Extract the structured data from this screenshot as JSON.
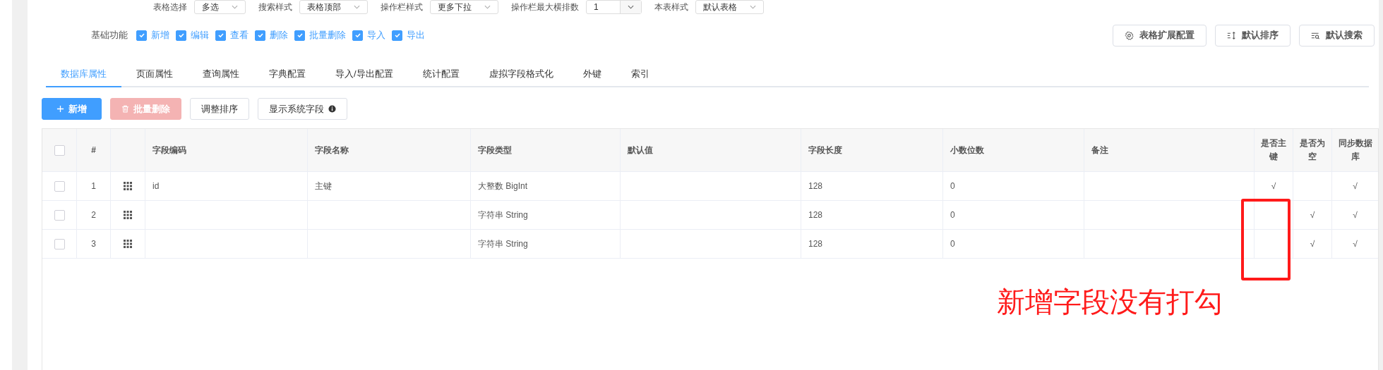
{
  "top_settings": [
    {
      "label": "表格选择",
      "value": "多选",
      "kind": "dropdown"
    },
    {
      "label": "搜索样式",
      "value": "表格顶部",
      "kind": "dropdown"
    },
    {
      "label": "操作栏样式",
      "value": "更多下拉",
      "kind": "dropdown"
    },
    {
      "label": "操作栏最大横排数",
      "value": "1",
      "kind": "number"
    },
    {
      "label": "本表样式",
      "value": "默认表格",
      "kind": "dropdown"
    }
  ],
  "basic_functions": {
    "label": "基础功能",
    "items": [
      {
        "label": "新增",
        "checked": true
      },
      {
        "label": "编辑",
        "checked": true
      },
      {
        "label": "查看",
        "checked": true
      },
      {
        "label": "删除",
        "checked": true
      },
      {
        "label": "批量删除",
        "checked": true
      },
      {
        "label": "导入",
        "checked": true
      },
      {
        "label": "导出",
        "checked": true
      }
    ]
  },
  "config_buttons": [
    {
      "label": "表格扩展配置",
      "kind": "gear"
    },
    {
      "label": "默认排序",
      "kind": "sort"
    },
    {
      "label": "默认搜索",
      "kind": "search"
    }
  ],
  "tabs": [
    {
      "label": "数据库属性",
      "selected": true
    },
    {
      "label": "页面属性",
      "selected": false
    },
    {
      "label": "查询属性",
      "selected": false
    },
    {
      "label": "字典配置",
      "selected": false
    },
    {
      "label": "导入/导出配置",
      "selected": false
    },
    {
      "label": "统计配置",
      "selected": false
    },
    {
      "label": "虚拟字段格式化",
      "selected": false
    },
    {
      "label": "外键",
      "selected": false
    },
    {
      "label": "索引",
      "selected": false
    }
  ],
  "actions": [
    {
      "label": "新增",
      "kind": "primary"
    },
    {
      "label": "批量删除",
      "kind": "danger",
      "disabled": true
    },
    {
      "label": "调整排序",
      "kind": "default"
    },
    {
      "label": "显示系统字段",
      "kind": "info"
    }
  ],
  "table": {
    "select_all_checked": false,
    "columns": [
      "#",
      "字段编码",
      "字段名称",
      "字段类型",
      "默认值",
      "字段长度",
      "小数位数",
      "备注",
      "是否主键",
      "是否为空",
      "同步数据库"
    ],
    "rows": [
      {
        "checked": false,
        "no": "1",
        "code": "id",
        "name": "主键",
        "type": "大整数 BigInt",
        "length": "128",
        "decimals": "0",
        "primary_key": "√",
        "sync": "√"
      },
      {
        "checked": false,
        "no": "2",
        "type": "字符串 String",
        "length": "128",
        "decimals": "0",
        "nullable": "√",
        "sync": "√"
      },
      {
        "checked": false,
        "no": "3",
        "type": "字符串 String",
        "length": "128",
        "decimals": "0",
        "nullable": "√",
        "sync": "√"
      }
    ]
  },
  "annotation": {
    "text": "新增字段没有打勾"
  }
}
